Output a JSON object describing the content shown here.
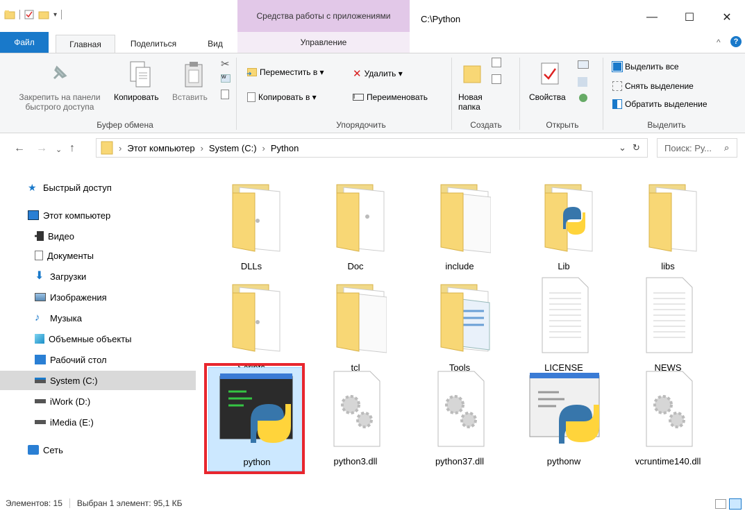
{
  "window": {
    "title": "C:\\Python",
    "context_tab": "Средства работы с приложениями",
    "context_subtab": "Управление",
    "minimize": "—",
    "maximize": "☐",
    "close": "✕"
  },
  "tabs": {
    "file": "Файл",
    "home": "Главная",
    "share": "Поделиться",
    "view": "Вид"
  },
  "ribbon": {
    "clipboard": {
      "pin_line1": "Закрепить на панели",
      "pin_line2": "быстрого доступа",
      "copy": "Копировать",
      "paste": "Вставить",
      "label": "Буфер обмена"
    },
    "organize": {
      "move_to": "Переместить в ▾",
      "copy_to": "Копировать в ▾",
      "delete": "Удалить ▾",
      "rename": "Переименовать",
      "label": "Упорядочить"
    },
    "new": {
      "new_folder_line1": "Новая",
      "new_folder_line2": "папка",
      "label": "Создать"
    },
    "open": {
      "properties": "Свойства",
      "label": "Открыть"
    },
    "select": {
      "select_all": "Выделить все",
      "select_none": "Снять выделение",
      "invert": "Обратить выделение",
      "label": "Выделить"
    }
  },
  "address": {
    "crumbs": [
      "Этот компьютер",
      "System (C:)",
      "Python"
    ],
    "search_placeholder": "Поиск: Ру..."
  },
  "nav": {
    "quick_access": "Быстрый доступ",
    "this_pc": "Этот компьютер",
    "video": "Видео",
    "documents": "Документы",
    "downloads": "Загрузки",
    "pictures": "Изображения",
    "music": "Музыка",
    "objects3d": "Объемные объекты",
    "desktop": "Рабочий стол",
    "system_c": "System (C:)",
    "iwork_d": "iWork (D:)",
    "imedia_e": "iMedia (E:)",
    "network": "Сеть"
  },
  "items": [
    {
      "name": "DLLs",
      "kind": "folder"
    },
    {
      "name": "Doc",
      "kind": "folder"
    },
    {
      "name": "include",
      "kind": "folder"
    },
    {
      "name": "Lib",
      "kind": "folder"
    },
    {
      "name": "libs",
      "kind": "folder"
    },
    {
      "name": "Scripts",
      "kind": "folder"
    },
    {
      "name": "tcl",
      "kind": "folder"
    },
    {
      "name": "Tools",
      "kind": "folder"
    },
    {
      "name": "LICENSE",
      "kind": "text"
    },
    {
      "name": "NEWS",
      "kind": "text"
    },
    {
      "name": "python",
      "kind": "exe",
      "selected": true
    },
    {
      "name": "python3.dll",
      "kind": "dll"
    },
    {
      "name": "python37.dll",
      "kind": "dll"
    },
    {
      "name": "pythonw",
      "kind": "exe"
    },
    {
      "name": "vcruntime140.dll",
      "kind": "dll"
    }
  ],
  "status": {
    "count": "Элементов: 15",
    "selection": "Выбран 1 элемент: 95,1 КБ"
  },
  "colors": {
    "accent": "#1979ca",
    "folder": "#f8d775",
    "context_tab": "#e2c8e8",
    "selection": "#cce8ff",
    "highlight_box": "#e8262e"
  }
}
